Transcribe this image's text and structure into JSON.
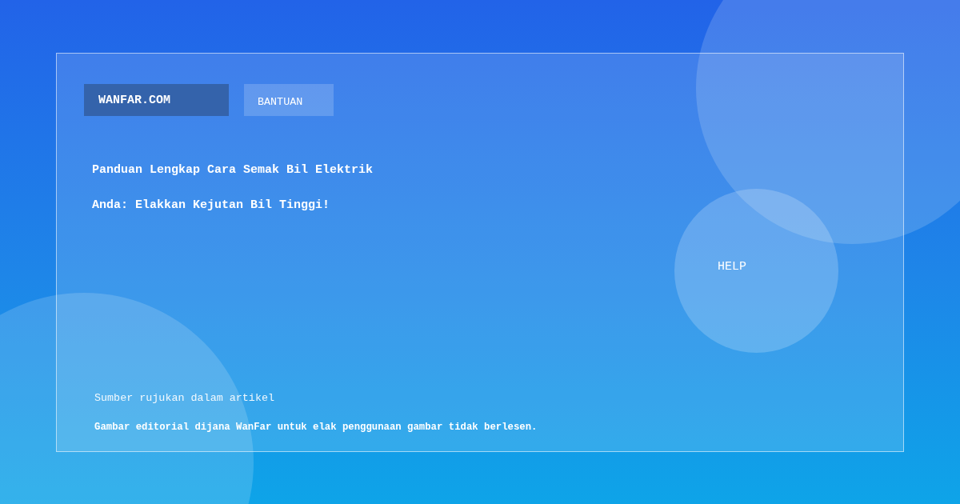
{
  "nav": [
    {
      "label": "WANFAR.COM",
      "kind": "brand"
    },
    {
      "label": "BANTUAN",
      "kind": "link"
    }
  ],
  "title": "Panduan Lengkap Cara Semak Bil Elektrik Anda: Elakkan Kejutan Bil Tinggi!",
  "help_button": {
    "label": "HELP"
  },
  "footer": {
    "source": "Sumber rujukan dalam artikel",
    "disclaimer": "Gambar editorial dijana WanFar untuk elak penggunaan gambar tidak berlesen."
  }
}
